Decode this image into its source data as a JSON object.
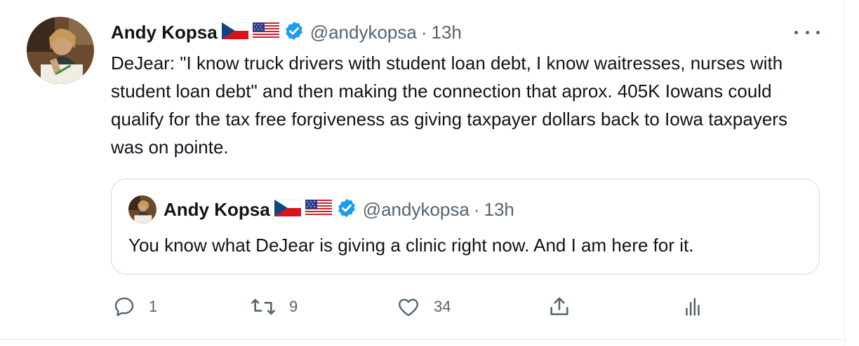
{
  "tweet": {
    "author_name": "Andy Kopsa",
    "flags": [
      "czech-flag",
      "us-flag"
    ],
    "verified": true,
    "handle": "@andykopsa",
    "separator": "·",
    "time": "13h",
    "text": "DeJear: \"I know truck drivers with student loan debt, I know waitresses, nurses with student loan debt\" and then making the connection that aprox. 405K Iowans could qualify for the tax free forgiveness as giving taxpayer dollars back to Iowa taxpayers was on pointe."
  },
  "quoted_tweet": {
    "author_name": "Andy Kopsa",
    "handle": "@andykopsa",
    "separator": "·",
    "time": "13h",
    "text": "You know what DeJear is giving a clinic right now. And I am here for it."
  },
  "actions": {
    "reply_count": "1",
    "retweet_count": "9",
    "like_count": "34"
  },
  "colors": {
    "text": "#0f1419",
    "secondary": "#536471",
    "verified": "#1d9bf0",
    "border": "#cfd9de"
  }
}
